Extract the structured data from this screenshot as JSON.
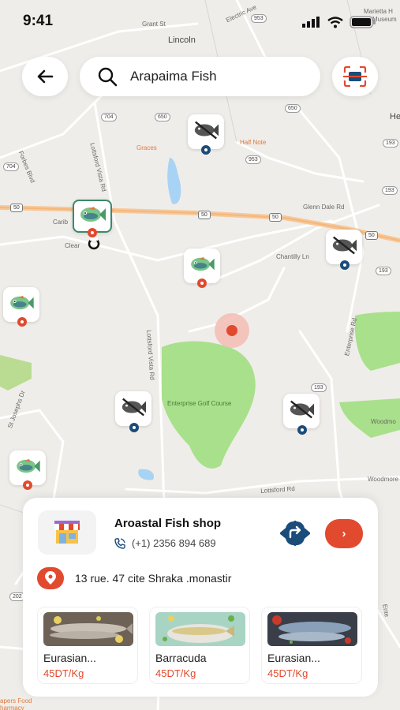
{
  "status_bar": {
    "time": "9:41"
  },
  "search": {
    "query": "Arapaima Fish"
  },
  "map_labels": {
    "lincoln": "Lincoln",
    "graces": "Graces",
    "half_note": "Half Note",
    "forbes": "Forbes Blvd",
    "lottsford_vista": "Lottsford Vista Rd",
    "glenn_dale": "Glenn Dale Rd",
    "chantilly": "Chantilly Ln",
    "enterprise_rd": "Enterprise Rd",
    "lottsford_vista_2": "Lottsford Vista Rd",
    "golf": "Enterprise Golf Course",
    "st_josephs": "St Josephs Dr",
    "lottsford_rd": "Lottsford Rd",
    "woodmore": "Woodmo",
    "woodmore2": "Woodmore",
    "grant_st": "Grant St",
    "electric_ave": "Electric Ave",
    "marietta": "Marietta H",
    "museum": "Museum",
    "he": "He",
    "caribou": "Carib",
    "cleary": "Clear",
    "enter": "Ente",
    "pers": "apers Food",
    "pharmacy": "harmacy",
    "hwy_953a": "953",
    "hwy_650a": "650",
    "hwy_704a": "704",
    "hwy_650b": "650",
    "hwy_193a": "193",
    "hwy_704b": "704",
    "hwy_953b": "953",
    "hwy_50a": "50",
    "hwy_50b": "50",
    "hwy_50c": "50",
    "hwy_50d": "50",
    "hwy_193b": "193",
    "hwy_193c": "193",
    "hwy_193d": "193",
    "hwy_202": "202"
  },
  "shop": {
    "name": "Aroastal Fish shop",
    "phone": "(+1) 2356 894 689",
    "address": "13 rue. 47 cite Shraka .monastir",
    "go_label": "›"
  },
  "products": [
    {
      "name": "Eurasian...",
      "price": "45DT/Kg"
    },
    {
      "name": "Barracuda",
      "price": "45DT/Kg"
    },
    {
      "name": "Eurasian...",
      "price": "45DT/Kg"
    }
  ],
  "colors": {
    "accent": "#e14a2e",
    "navy": "#1b4c7a",
    "green": "#3a8a6a",
    "park": "#a8e08a"
  },
  "icons": {
    "back": "arrow-left-icon",
    "search": "search-icon",
    "scan": "scan-icon",
    "fish": "fish-icon",
    "fish_off": "fish-off-icon",
    "location": "location-pin-icon",
    "store": "store-icon",
    "phone": "phone-icon",
    "directions": "directions-icon"
  }
}
